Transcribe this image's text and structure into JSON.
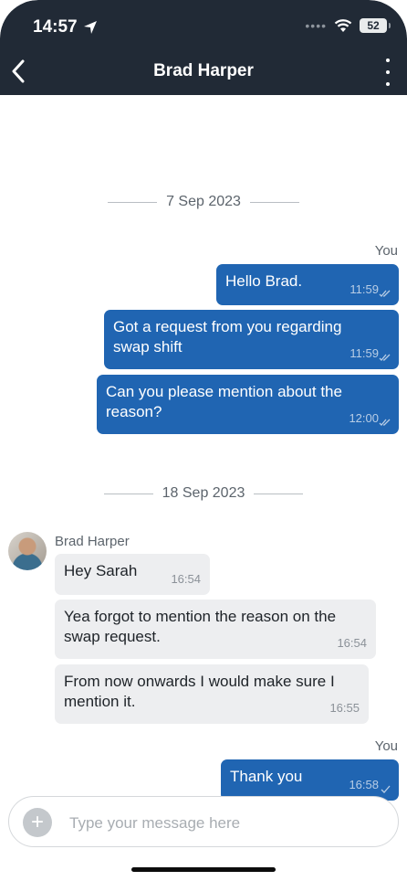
{
  "status_bar": {
    "time": "14:57",
    "battery": "52"
  },
  "header": {
    "title": "Brad Harper"
  },
  "dates": [
    "7 Sep 2023",
    "18 Sep 2023"
  ],
  "you_label": "You",
  "outgoing_group1": [
    {
      "text": "Hello Brad.",
      "time": "11:59"
    },
    {
      "text": "Got a request from you regarding\nswap shift",
      "time": "11:59"
    },
    {
      "text": "Can you please mention about the\nreason?",
      "time": "12:00"
    }
  ],
  "incoming": {
    "sender": "Brad Harper",
    "messages": [
      {
        "text": "Hey Sarah",
        "time": "16:54"
      },
      {
        "text": "Yea forgot to mention the reason on the\nswap request.",
        "time": "16:54"
      },
      {
        "text": "From now onwards I would make sure I\nmention it.",
        "time": "16:55"
      }
    ]
  },
  "outgoing_group2": [
    {
      "text": "Thank you",
      "time": "16:58"
    }
  ],
  "composer": {
    "placeholder": "Type your message here"
  }
}
